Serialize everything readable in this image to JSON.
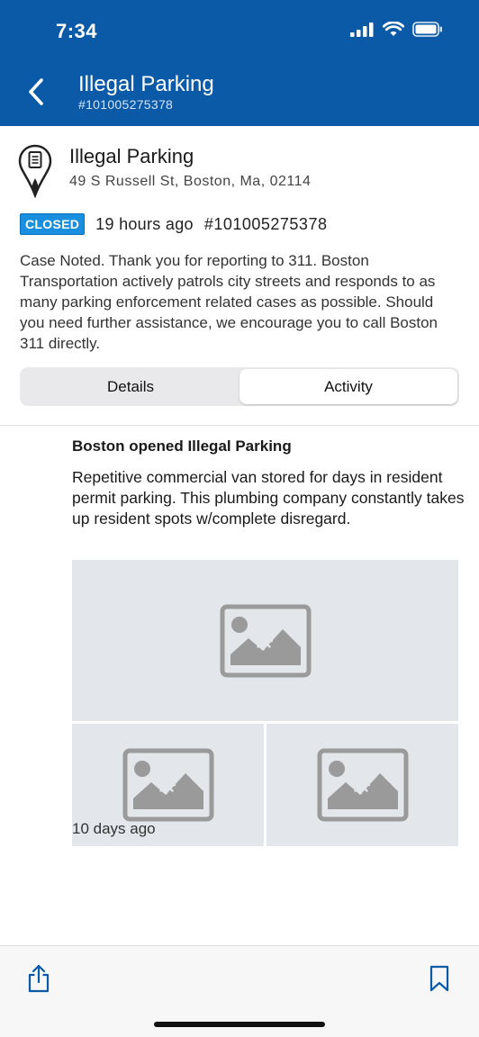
{
  "status": {
    "time": "7:34"
  },
  "nav": {
    "title": "Illegal Parking",
    "subtitle": "#101005275378"
  },
  "case": {
    "title": "Illegal Parking",
    "address": "49 S Russell St, Boston, Ma, 02114",
    "status_badge": "CLOSED",
    "time_ago": "19 hours ago",
    "id": "#101005275378",
    "description": "Case Noted. Thank you for reporting to 311. Boston Transportation actively patrols city streets and responds to as many parking enforcement related cases as possible. Should you need further assistance, we encourage you to call Boston 311 directly."
  },
  "tabs": [
    {
      "label": "Details",
      "active": false
    },
    {
      "label": "Activity",
      "active": true
    }
  ],
  "activity": {
    "title": "Boston opened Illegal Parking",
    "body": "Repetitive commercial van stored for days in resident permit parking. This plumbing company constantly takes up resident spots w/complete disregard.",
    "time_ago": "10 days ago"
  },
  "colors": {
    "header": "#0a5aa8",
    "badge": "#1a8fe0",
    "placeholder_bg": "#e3e6ea"
  },
  "icons": {
    "back": "chevron-left-icon",
    "case": "map-pin-document-icon",
    "image": "image-placeholder-icon",
    "share": "share-icon",
    "bookmark": "bookmark-icon"
  }
}
